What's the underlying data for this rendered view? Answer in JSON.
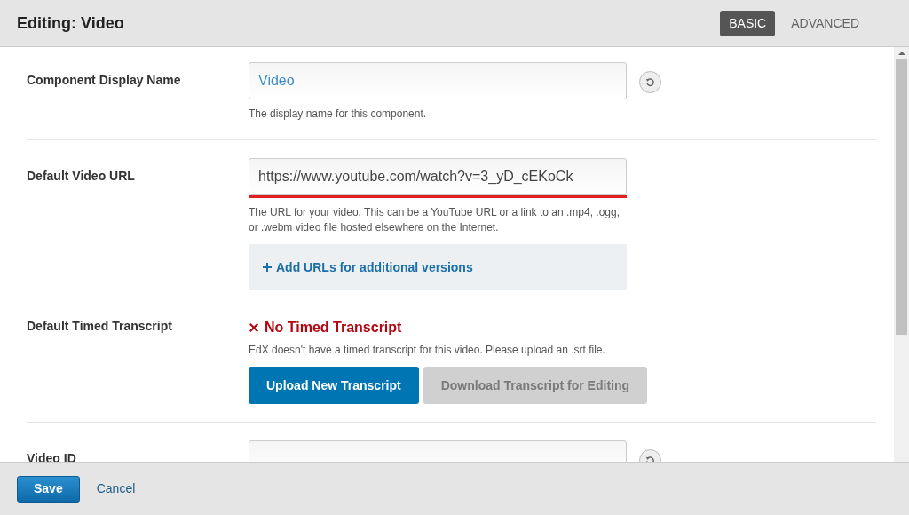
{
  "header": {
    "title": "Editing: Video",
    "tabs": [
      {
        "label": "BASIC",
        "selected": true
      },
      {
        "label": "ADVANCED",
        "selected": false
      }
    ]
  },
  "fields": [
    {
      "kind": "text",
      "label": "Component Display Name",
      "value": "Video",
      "help": "The display name for this component.",
      "reset": true,
      "marked": false,
      "divider": true
    },
    {
      "kind": "url",
      "label": "Default Video URL",
      "value": "https://www.youtube.com/watch?v=3_yD_cEKoCk",
      "help": "The URL for your video. This can be a YouTube URL or a link to an .mp4, .ogg, or .webm video file hosted elsewhere on the Internet.",
      "add_link": "Add URLs for additional versions",
      "reset": false,
      "marked": true,
      "divider": false
    },
    {
      "kind": "transcript",
      "label": "Default Timed Transcript",
      "status": "No Timed Transcript",
      "help": "EdX doesn't have a timed transcript for this video. Please upload an .srt file.",
      "buttons": [
        {
          "label": "Upload New Transcript",
          "disabled": false
        },
        {
          "label": "Download Transcript for Editing",
          "disabled": true
        }
      ],
      "divider": true
    },
    {
      "kind": "text",
      "label": "Video ID",
      "reset": true,
      "marked": false,
      "divider": false
    }
  ],
  "footer": {
    "save": "Save",
    "cancel": "Cancel"
  }
}
